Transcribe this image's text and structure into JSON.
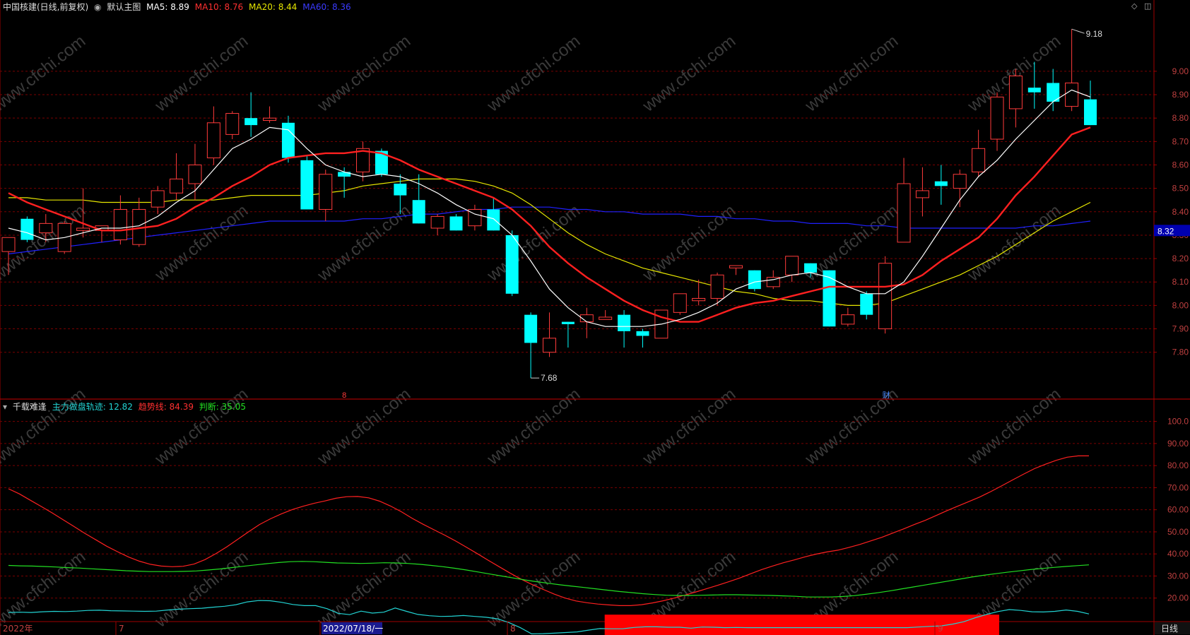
{
  "main_header": {
    "stock": "中国核建(日线,前复权)",
    "template": "默认主图",
    "ma5": "MA5: 8.89",
    "ma10": "MA10: 8.76",
    "ma20": "MA20: 8.44",
    "ma60": "MA60: 8.36"
  },
  "sub_header": {
    "name": "千载难逢",
    "track": "主力做盘轨迹: 12.82",
    "trend": "趋势线: 84.39",
    "judge": "判断: 35.05"
  },
  "watermark": "www.cfchi.com",
  "colors": {
    "up": "#ff3b3b",
    "down": "#00ffff",
    "ma5": "#ffffff",
    "ma10": "#ff2020",
    "ma20": "#e6e600",
    "ma60": "#2020ff",
    "grid": "#7a0000",
    "axis_text": "#c04040"
  },
  "price_axis": [
    "9.00",
    "8.90",
    "8.80",
    "8.70",
    "8.60",
    "8.50",
    "8.40",
    "8.30",
    "8.20",
    "8.10",
    "8.00",
    "7.90",
    "7.80"
  ],
  "current_price": "8.32",
  "osc_axis": [
    "100.0",
    "90.00",
    "80.00",
    "70.00",
    "60.00",
    "50.00",
    "40.00",
    "30.00",
    "20.00"
  ],
  "date_axis": [
    "2022年",
    "7",
    "2022/07/18/一",
    "8",
    "9"
  ],
  "period_label": "日线",
  "markers": {
    "high": "9.18",
    "low": "7.68",
    "month_mark": "8",
    "event_mark": "财"
  },
  "chart_data": {
    "type": "candlestick",
    "ylim": [
      7.6,
      9.25
    ],
    "candles": [
      [
        8.23,
        8.29,
        8.13,
        8.29
      ],
      [
        8.37,
        8.38,
        8.27,
        8.28
      ],
      [
        8.31,
        8.39,
        8.27,
        8.35
      ],
      [
        8.23,
        8.36,
        8.22,
        8.35
      ],
      [
        8.32,
        8.5,
        8.29,
        8.33
      ],
      [
        8.32,
        8.34,
        8.27,
        8.34
      ],
      [
        8.28,
        8.47,
        8.26,
        8.41
      ],
      [
        8.26,
        8.46,
        8.25,
        8.41
      ],
      [
        8.42,
        8.51,
        8.39,
        8.49
      ],
      [
        8.48,
        8.65,
        8.45,
        8.54
      ],
      [
        8.52,
        8.69,
        8.45,
        8.6
      ],
      [
        8.63,
        8.85,
        8.6,
        8.78
      ],
      [
        8.73,
        8.83,
        8.71,
        8.82
      ],
      [
        8.8,
        8.91,
        8.72,
        8.77
      ],
      [
        8.79,
        8.85,
        8.78,
        8.8
      ],
      [
        8.78,
        8.81,
        8.61,
        8.63
      ],
      [
        8.62,
        8.64,
        8.41,
        8.41
      ],
      [
        8.41,
        8.58,
        8.36,
        8.56
      ],
      [
        8.57,
        8.59,
        8.46,
        8.55
      ],
      [
        8.57,
        8.7,
        8.53,
        8.67
      ],
      [
        8.66,
        8.67,
        8.55,
        8.56
      ],
      [
        8.52,
        8.56,
        8.39,
        8.47
      ],
      [
        8.45,
        8.56,
        8.35,
        8.35
      ],
      [
        8.33,
        8.39,
        8.3,
        8.38
      ],
      [
        8.38,
        8.39,
        8.32,
        8.32
      ],
      [
        8.34,
        8.43,
        8.32,
        8.41
      ],
      [
        8.41,
        8.46,
        8.32,
        8.32
      ],
      [
        8.3,
        8.32,
        8.04,
        8.05
      ],
      [
        7.96,
        7.97,
        7.69,
        7.84
      ],
      [
        7.8,
        7.97,
        7.78,
        7.86
      ],
      [
        7.93,
        7.93,
        7.82,
        7.92
      ],
      [
        7.93,
        7.99,
        7.86,
        7.96
      ],
      [
        7.94,
        7.98,
        7.94,
        7.95
      ],
      [
        7.96,
        7.98,
        7.82,
        7.89
      ],
      [
        7.89,
        7.9,
        7.82,
        7.87
      ],
      [
        7.86,
        7.97,
        7.86,
        7.98
      ],
      [
        7.97,
        8.04,
        7.96,
        8.05
      ],
      [
        8.02,
        8.11,
        8.0,
        8.03
      ],
      [
        8.03,
        8.14,
        8.0,
        8.13
      ],
      [
        8.16,
        8.17,
        8.13,
        8.17
      ],
      [
        8.15,
        8.15,
        8.06,
        8.07
      ],
      [
        8.08,
        8.15,
        8.07,
        8.12
      ],
      [
        8.13,
        8.21,
        8.1,
        8.21
      ],
      [
        8.18,
        8.18,
        8.12,
        8.14
      ],
      [
        8.15,
        8.15,
        7.91,
        7.91
      ],
      [
        7.92,
        7.99,
        7.91,
        7.96
      ],
      [
        8.05,
        8.06,
        7.94,
        7.96
      ],
      [
        7.9,
        8.21,
        7.88,
        8.18
      ],
      [
        8.27,
        8.63,
        8.27,
        8.52
      ],
      [
        8.46,
        8.59,
        8.38,
        8.49
      ],
      [
        8.53,
        8.6,
        8.43,
        8.51
      ],
      [
        8.5,
        8.58,
        8.42,
        8.56
      ],
      [
        8.57,
        8.75,
        8.55,
        8.67
      ],
      [
        8.71,
        8.91,
        8.66,
        8.89
      ],
      [
        8.84,
        9.01,
        8.76,
        8.98
      ],
      [
        8.93,
        9.04,
        8.84,
        8.91
      ],
      [
        8.95,
        9.01,
        8.83,
        8.87
      ],
      [
        8.85,
        9.18,
        8.83,
        8.95
      ],
      [
        8.88,
        8.96,
        8.77,
        8.77
      ]
    ],
    "ma5": [
      8.33,
      8.31,
      8.28,
      8.29,
      8.31,
      8.33,
      8.33,
      8.34,
      8.38,
      8.44,
      8.49,
      8.58,
      8.67,
      8.71,
      8.76,
      8.75,
      8.67,
      8.6,
      8.57,
      8.55,
      8.56,
      8.55,
      8.52,
      8.48,
      8.43,
      8.39,
      8.37,
      8.3,
      8.19,
      8.07,
      7.99,
      7.93,
      7.91,
      7.91,
      7.91,
      7.92,
      7.94,
      7.97,
      8.01,
      8.07,
      8.1,
      8.11,
      8.13,
      8.14,
      8.12,
      8.08,
      8.05,
      8.05,
      8.1,
      8.21,
      8.33,
      8.45,
      8.55,
      8.62,
      8.71,
      8.79,
      8.87,
      8.92,
      8.89
    ],
    "ma10": [
      8.48,
      8.44,
      8.41,
      8.38,
      8.35,
      8.32,
      8.32,
      8.33,
      8.34,
      8.37,
      8.42,
      8.46,
      8.51,
      8.55,
      8.6,
      8.63,
      8.64,
      8.65,
      8.65,
      8.66,
      8.65,
      8.62,
      8.58,
      8.55,
      8.52,
      8.49,
      8.46,
      8.41,
      8.34,
      8.25,
      8.18,
      8.12,
      8.07,
      8.02,
      7.98,
      7.95,
      7.93,
      7.93,
      7.96,
      7.99,
      8.01,
      8.02,
      8.04,
      8.06,
      8.08,
      8.08,
      8.08,
      8.08,
      8.09,
      8.13,
      8.19,
      8.24,
      8.29,
      8.37,
      8.47,
      8.55,
      8.64,
      8.73,
      8.76
    ],
    "ma20": [
      8.46,
      8.46,
      8.45,
      8.45,
      8.45,
      8.44,
      8.44,
      8.44,
      8.44,
      8.45,
      8.45,
      8.45,
      8.46,
      8.47,
      8.47,
      8.47,
      8.47,
      8.48,
      8.49,
      8.51,
      8.52,
      8.53,
      8.54,
      8.54,
      8.54,
      8.53,
      8.51,
      8.48,
      8.43,
      8.37,
      8.31,
      8.26,
      8.22,
      8.19,
      8.16,
      8.14,
      8.12,
      8.1,
      8.08,
      8.06,
      8.05,
      8.03,
      8.02,
      8.02,
      8.01,
      8.0,
      8.0,
      8.01,
      8.04,
      8.07,
      8.1,
      8.13,
      8.17,
      8.21,
      8.26,
      8.31,
      8.36,
      8.4,
      8.44
    ],
    "ma60": [
      8.22,
      8.23,
      8.24,
      8.25,
      8.26,
      8.27,
      8.28,
      8.29,
      8.3,
      8.31,
      8.32,
      8.33,
      8.34,
      8.35,
      8.36,
      8.36,
      8.36,
      8.36,
      8.36,
      8.37,
      8.37,
      8.38,
      8.39,
      8.39,
      8.4,
      8.41,
      8.41,
      8.42,
      8.42,
      8.42,
      8.41,
      8.41,
      8.4,
      8.4,
      8.39,
      8.39,
      8.39,
      8.38,
      8.38,
      8.37,
      8.37,
      8.36,
      8.36,
      8.35,
      8.35,
      8.35,
      8.34,
      8.34,
      8.33,
      8.33,
      8.33,
      8.33,
      8.33,
      8.33,
      8.33,
      8.34,
      8.34,
      8.35,
      8.36
    ],
    "osc_ylim": [
      10,
      105
    ],
    "trend_line": [
      69.5,
      67.2,
      64.3,
      61.5,
      58.6,
      55.5,
      52.4,
      49.3,
      46.4,
      43.5,
      41.0,
      38.6,
      36.7,
      35.3,
      34.5,
      34.2,
      34.4,
      35.4,
      37.4,
      40.1,
      43.2,
      46.6,
      50.0,
      53.3,
      55.9,
      58.1,
      60.1,
      61.6,
      62.9,
      64.0,
      65.2,
      65.9,
      66.0,
      65.4,
      63.9,
      61.7,
      59.1,
      56.1,
      53.4,
      50.9,
      48.4,
      45.8,
      42.9,
      40.0,
      37.0,
      34.1,
      31.2,
      28.5,
      26.1,
      23.9,
      21.8,
      20.0,
      18.7,
      17.9,
      17.3,
      16.9,
      16.6,
      16.6,
      17.0,
      17.8,
      18.8,
      20.0,
      21.4,
      22.8,
      24.3,
      25.8,
      27.4,
      29.1,
      31.0,
      32.9,
      34.5,
      36.0,
      37.3,
      38.7,
      39.9,
      40.9,
      41.7,
      42.9,
      44.3,
      45.9,
      47.5,
      49.4,
      51.3,
      53.3,
      55.2,
      57.4,
      59.6,
      61.7,
      63.7,
      65.8,
      68.2,
      70.8,
      73.5,
      76.1,
      78.6,
      80.6,
      82.4,
      83.8,
      84.4,
      84.39
    ],
    "judge_line": [
      34.8,
      34.6,
      34.5,
      34.3,
      34.1,
      33.8,
      33.6,
      33.3,
      33.0,
      32.7,
      32.4,
      32.2,
      32.0,
      32.0,
      32.0,
      32.1,
      32.3,
      32.7,
      33.2,
      33.8,
      34.4,
      35.0,
      35.6,
      36.1,
      36.5,
      36.6,
      36.5,
      36.2,
      35.9,
      35.8,
      35.7,
      35.8,
      36.0,
      35.9,
      35.7,
      35.3,
      34.8,
      34.2,
      33.5,
      32.7,
      31.8,
      30.9,
      30.0,
      29.1,
      28.2,
      27.4,
      26.7,
      26.0,
      25.4,
      24.8,
      24.2,
      23.6,
      23.0,
      22.5,
      22.0,
      21.6,
      21.3,
      21.2,
      21.2,
      21.3,
      21.4,
      21.5,
      21.5,
      21.4,
      21.3,
      21.2,
      21.0,
      20.8,
      20.5,
      20.5,
      20.5,
      20.7,
      21.1,
      21.7,
      22.4,
      23.2,
      24.1,
      25.0,
      25.9,
      26.8,
      27.7,
      28.6,
      29.5,
      30.3,
      31.0,
      31.7,
      32.3,
      32.9,
      33.4,
      33.9,
      34.3,
      34.7,
      35.05
    ],
    "track_line": [
      13.5,
      13.6,
      13.5,
      13.8,
      14.0,
      13.9,
      14.1,
      14.4,
      14.5,
      14.3,
      14.2,
      14.1,
      14.0,
      14.1,
      14.6,
      15.0,
      15.2,
      15.4,
      15.9,
      16.3,
      17.0,
      18.3,
      18.9,
      18.8,
      18.1,
      17.1,
      16.6,
      16.6,
      15.2,
      13.1,
      12.5,
      14.1,
      13.2,
      13.6,
      15.5,
      14.0,
      12.6,
      12.0,
      11.7,
      11.8,
      12.1,
      11.7,
      11.3,
      10.6,
      8.9,
      6.6,
      3.8,
      3.9,
      4.1,
      4.4,
      4.7,
      5.5,
      6.2,
      6.1,
      6.1,
      6.7,
      7.0,
      7.0,
      6.8,
      6.8,
      6.4,
      6.9,
      6.8,
      6.6,
      6.7,
      6.6,
      6.6,
      6.6,
      6.6,
      6.6,
      6.6,
      6.6,
      6.6,
      6.6,
      6.6,
      6.6,
      6.6,
      6.6,
      6.6,
      6.6,
      6.9,
      7.2,
      7.4,
      8.2,
      9.3,
      11.1,
      12.6,
      13.9,
      14.8,
      14.4,
      13.8,
      13.7,
      14.0,
      14.6,
      14.0,
      12.82
    ],
    "signal_bar": {
      "from_index": 32,
      "to_index": 53,
      "color": "#ff0000"
    }
  }
}
